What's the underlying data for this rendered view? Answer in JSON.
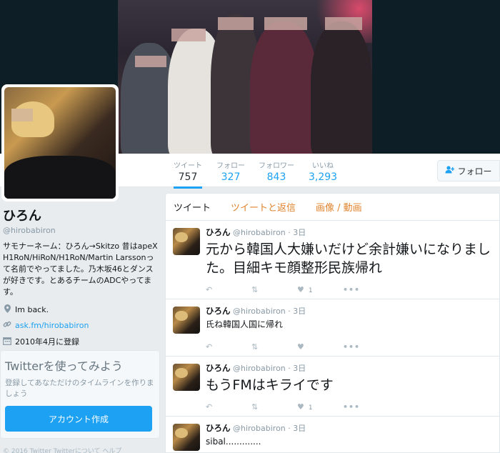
{
  "profile": {
    "name": "ひろん",
    "handle": "@hirobabiron",
    "bio": "サモナーネーム：ひろん→Skitzo 昔はapeX H1RoN/HiRoN/H1RoN/Martin Larssonって名前でやってました。乃木坂46とダンスが好きです。とあるチームのADCやってます。",
    "location": "Im back.",
    "url": "ask.fm/hirobabiron",
    "joined": "2010年4月に登録"
  },
  "stats": {
    "tweets_label": "ツイート",
    "tweets_value": "757",
    "following_label": "フォロー",
    "following_value": "327",
    "followers_label": "フォロワー",
    "followers_value": "843",
    "likes_label": "いいね",
    "likes_value": "3,293"
  },
  "follow_button": {
    "icon": "add-user-icon",
    "label": "フォロー"
  },
  "tabs": [
    "ツイート",
    "ツイートと返信",
    "画像 / 動画"
  ],
  "tweets": [
    {
      "name": "ひろん",
      "handle": "@hirobabiron",
      "time": "· 3日",
      "text": "元から韓国人大嫌いだけど余計嫌いになりました。目細キモ顔整形民族帰れ",
      "size": "big",
      "likes": "1"
    },
    {
      "name": "ひろん",
      "handle": "@hirobabiron",
      "time": "· 3日",
      "text": "氏ね韓国人国に帰れ",
      "size": "small",
      "likes": ""
    },
    {
      "name": "ひろん",
      "handle": "@hirobabiron",
      "time": "· 3日",
      "text": "もうFMはキライです",
      "size": "big",
      "likes": "1"
    },
    {
      "name": "ひろん",
      "handle": "@hirobabiron",
      "time": "· 3日",
      "text": "sibal.............",
      "size": "small",
      "likes": ""
    }
  ],
  "signup": {
    "title": "Twitterを使ってみよう",
    "text": "登録してあなただけのタイムラインを作りましょう",
    "button": "アカウント作成"
  },
  "footer": "© 2016 Twitter  Twitterについて  ヘルプ",
  "colors": {
    "accent": "#1da1f2",
    "tab_inactive": "#e0842e",
    "header_bg": "#0d1e26"
  }
}
